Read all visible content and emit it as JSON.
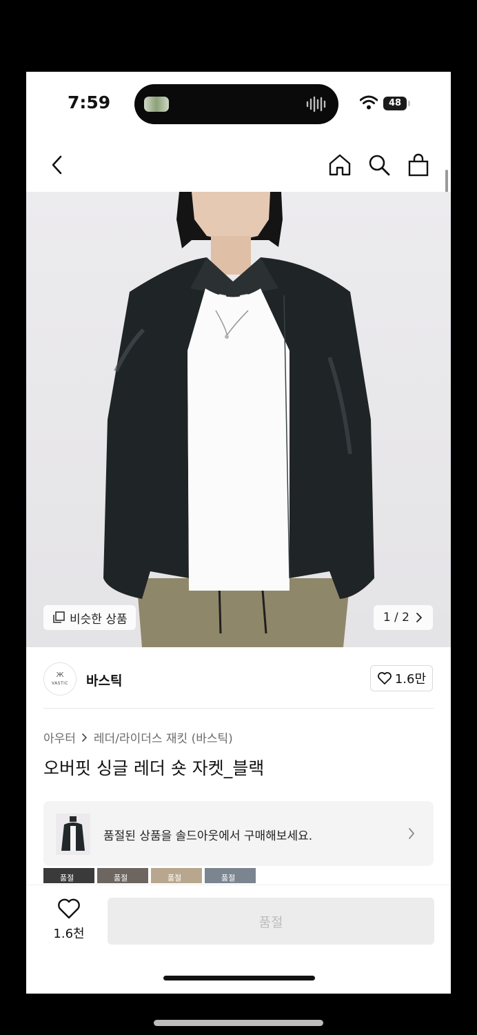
{
  "status_bar": {
    "time": "7:59",
    "battery": "48"
  },
  "image": {
    "similar_label": "비슷한 상품",
    "page_indicator": "1 / 2",
    "current_page": 1,
    "total_pages": 2
  },
  "brand": {
    "logo_mark": "Ж",
    "logo_text": "VASTIC",
    "name": "바스틱",
    "likes": "1.6만"
  },
  "breadcrumb": {
    "category": "아우터",
    "subcategory": "레더/라이더스 재킷 (바스틱)"
  },
  "product": {
    "title": "오버핏 싱글 레더 숏 자켓_블랙"
  },
  "soldout_banner": {
    "text": "품절된 상품을 솔드아웃에서 구매해보세요."
  },
  "thumb_strip": [
    {
      "label": "품절"
    },
    {
      "label": "품절"
    },
    {
      "label": "품절"
    },
    {
      "label": "품절"
    }
  ],
  "bottom_bar": {
    "wish_count": "1.6천",
    "buy_label": "품절"
  },
  "colors": {
    "accent": "#111111",
    "disabled_bg": "#ececec",
    "disabled_text": "#bdbdbd"
  }
}
